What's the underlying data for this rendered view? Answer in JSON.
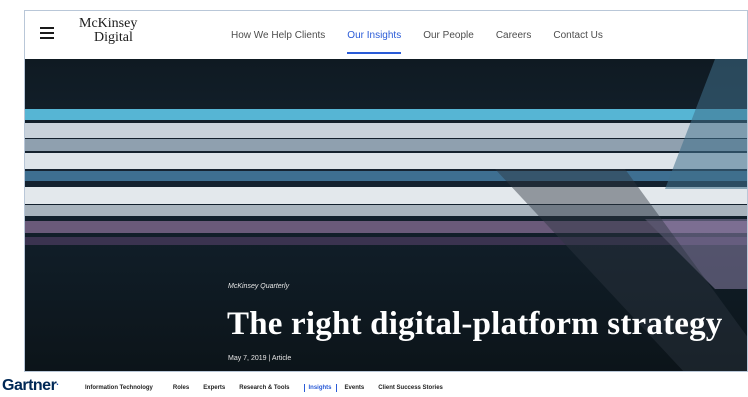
{
  "mckinsey": {
    "logo_line1": "McKinsey",
    "logo_line2": "Digital",
    "nav": [
      {
        "label": "How We Help Clients",
        "active": false
      },
      {
        "label": "Our Insights",
        "active": true
      },
      {
        "label": "Our People",
        "active": false
      },
      {
        "label": "Careers",
        "active": false
      },
      {
        "label": "Contact Us",
        "active": false
      }
    ],
    "hero": {
      "eyebrow": "McKinsey Quarterly",
      "title": "The right digital-platform strategy",
      "meta": "May 7, 2019 | Article"
    },
    "icons": [
      "hamburger-menu-icon"
    ]
  },
  "gartner": {
    "logo": "Gartner",
    "nav": [
      {
        "label": "Information Technology",
        "active": false
      },
      {
        "label": "Roles",
        "active": false
      },
      {
        "label": "Experts",
        "active": false
      },
      {
        "label": "Research & Tools",
        "active": false
      },
      {
        "label": "Insights",
        "active": true
      },
      {
        "label": "Events",
        "active": false
      },
      {
        "label": "Client Success Stories",
        "active": false
      }
    ],
    "accent_color": "#2a5bd7"
  },
  "colors": {
    "accent": "#2a5bd7",
    "hero_bg": "#0f1a22",
    "gartner_brand": "#002856"
  }
}
